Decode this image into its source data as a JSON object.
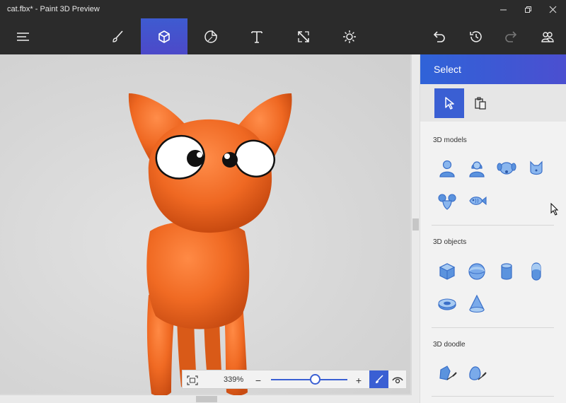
{
  "window": {
    "title": "cat.fbx* - Paint 3D Preview",
    "controls": [
      "minimize-icon",
      "restore-icon",
      "close-icon"
    ]
  },
  "toolbar": {
    "tools": [
      {
        "name": "menu",
        "icon": "hamburger-icon"
      },
      {
        "name": "brushes",
        "icon": "brush-icon"
      },
      {
        "name": "3d-objects",
        "icon": "cube-icon",
        "active": true
      },
      {
        "name": "stickers",
        "icon": "sticker-icon"
      },
      {
        "name": "text",
        "icon": "text-icon"
      },
      {
        "name": "canvas",
        "icon": "canvas-resize-icon"
      },
      {
        "name": "effects",
        "icon": "sun-icon"
      }
    ],
    "actions": [
      "undo-icon",
      "history-icon",
      "redo-icon",
      "community-icon"
    ]
  },
  "zoom": {
    "percent_label": "339%",
    "level": 0.58,
    "minus": "−",
    "plus": "+"
  },
  "panel": {
    "title": "Select",
    "sections": [
      {
        "title": "3D models",
        "items": [
          "man-model-icon",
          "woman-model-icon",
          "dog-model-icon",
          "cat-model-icon",
          "mouse-model-icon",
          "fish-model-icon"
        ]
      },
      {
        "title": "3D objects",
        "items": [
          "cube-object-icon",
          "sphere-object-icon",
          "cylinder-object-icon",
          "capsule-object-icon",
          "torus-object-icon",
          "cone-object-icon"
        ]
      },
      {
        "title": "3D doodle",
        "items": [
          "sharp-edge-doodle-icon",
          "soft-edge-doodle-icon"
        ]
      }
    ]
  },
  "colors": {
    "accent": "#3a5fd3",
    "toolbar_bg": "#2b2b2b",
    "cat_orange": "#f06a23",
    "icon_blue": "#6aa0e6"
  }
}
